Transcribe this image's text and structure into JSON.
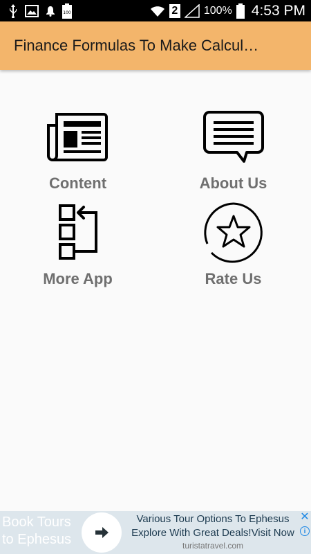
{
  "status_bar": {
    "left_icons": [
      "usb-icon",
      "image-icon",
      "notification-bell-icon",
      "battery-100-icon"
    ],
    "sim_badge": "2",
    "battery_percent": "100%",
    "time": "4:53 PM"
  },
  "app_bar": {
    "title": "Finance Formulas To Make Calcul…",
    "color": "#f3b56b"
  },
  "menu": {
    "items": [
      {
        "label": "Content",
        "icon": "newspaper-icon"
      },
      {
        "label": "About Us",
        "icon": "chat-bubble-icon"
      },
      {
        "label": "More App",
        "icon": "app-list-icon"
      },
      {
        "label": "Rate Us",
        "icon": "star-circle-icon"
      }
    ]
  },
  "ad": {
    "left_text": "Book Tours to Ephesus",
    "headline": "Various Tour Options To Ephesus Explore With Great Deals!Visit Now",
    "domain": "turistatravel.com",
    "close_glyph": "✕",
    "info_glyph": "i"
  }
}
